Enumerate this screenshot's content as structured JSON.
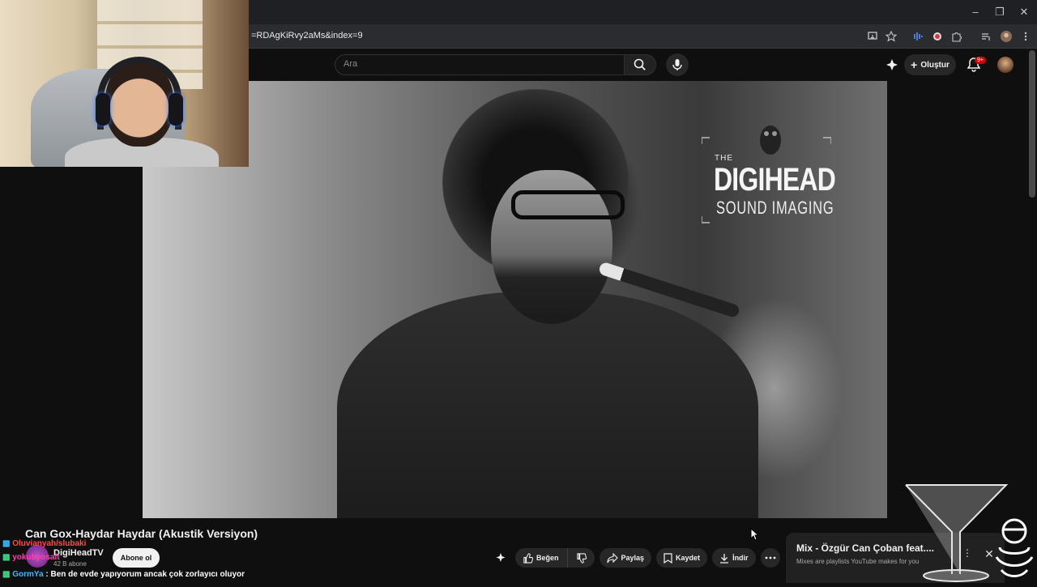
{
  "browser": {
    "url": "=RDAgKiRvy2aMs&index=9",
    "window_controls": [
      "minimize",
      "restore",
      "close"
    ]
  },
  "youtube_header": {
    "search_placeholder": "Ara",
    "create_label": "Oluştur",
    "notification_badge": "9+"
  },
  "video": {
    "logo_the": "THE",
    "logo_main": "DIGIHEAD",
    "logo_sub": "SOUND IMAGING"
  },
  "info": {
    "title": "Can Gox-Haydar Haydar (Akustik Versiyon)",
    "channel_name": "DigiHeadTV",
    "subscribers": "42 B abone",
    "subscribe_label": "Abone ol"
  },
  "actions": {
    "like_label": "Beğen",
    "share_label": "Paylaş",
    "save_label": "Kaydet",
    "download_label": "İndir"
  },
  "mix": {
    "title": "Mix - Özgür Can Çoban feat....",
    "subtitle": "Mixes are playlists YouTube makes for you"
  },
  "chat": {
    "line1_user": "Oluvianyah/slubaki",
    "line1_msg": "",
    "line2_user": "yokubyosalt",
    "line3_user": "GormYa",
    "line3_msg": " : Ben de evde yapıyorum ancak çok zorlayıcı oluyor"
  },
  "colors": {
    "background": "#0f0f0f",
    "accent_red": "#cc0000",
    "button_bg": "#272727"
  }
}
